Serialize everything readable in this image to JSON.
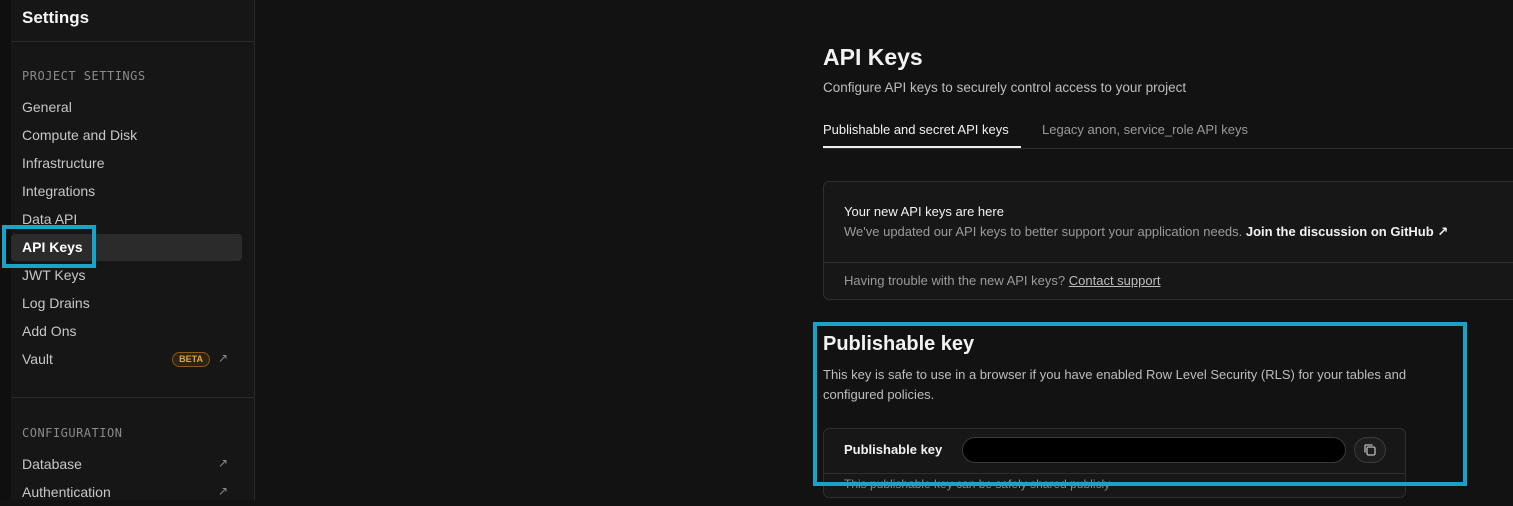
{
  "sidebar": {
    "title": "Settings",
    "sections": [
      {
        "label": "PROJECT SETTINGS",
        "items": [
          {
            "label": "General"
          },
          {
            "label": "Compute and Disk"
          },
          {
            "label": "Infrastructure"
          },
          {
            "label": "Integrations"
          },
          {
            "label": "Data API"
          },
          {
            "label": "API Keys",
            "active": true
          },
          {
            "label": "JWT Keys"
          },
          {
            "label": "Log Drains"
          },
          {
            "label": "Add Ons"
          },
          {
            "label": "Vault",
            "badge": "BETA",
            "external": true
          }
        ]
      },
      {
        "label": "CONFIGURATION",
        "items": [
          {
            "label": "Database",
            "external": true
          },
          {
            "label": "Authentication",
            "external": true
          }
        ]
      }
    ]
  },
  "main": {
    "title": "API Keys",
    "subtitle": "Configure API keys to securely control access to your project",
    "tabs": [
      {
        "label": "Publishable and secret API keys",
        "active": true
      },
      {
        "label": "Legacy anon, service_role API keys",
        "active": false
      }
    ],
    "notice": {
      "title": "Your new API keys are here",
      "body": "We've updated our API keys to better support your application needs.",
      "link": "Join the discussion on GitHub",
      "footer_text": "Having trouble with the new API keys?",
      "footer_link": "Contact support"
    },
    "publishable": {
      "title": "Publishable key",
      "description": "This key is safe to use in a browser if you have enabled Row Level Security (RLS) for your tables and configured policies.",
      "row_label": "Publishable key",
      "hint": "This publishable key can be safely shared publicly"
    }
  },
  "colors": {
    "accent_highlight": "#1aa3c9",
    "background": "#121212",
    "beta_badge": "#e8a33a"
  },
  "icons": {
    "external": "external-link-icon",
    "copy": "copy-icon"
  }
}
